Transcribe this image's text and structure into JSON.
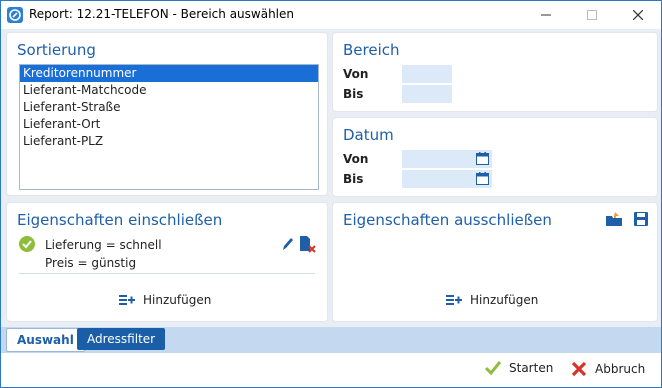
{
  "window": {
    "title": "Report: 12.21-TELEFON - Bereich auswählen"
  },
  "sortierung": {
    "title": "Sortierung",
    "items": [
      "Kreditorennummer",
      "Lieferant-Matchcode",
      "Lieferant-Straße",
      "Lieferant-Ort",
      "Lieferant-PLZ"
    ],
    "selected": "Kreditorennummer"
  },
  "bereich": {
    "title": "Bereich",
    "von_label": "Von",
    "bis_label": "Bis",
    "von_value": "",
    "bis_value": ""
  },
  "datum": {
    "title": "Datum",
    "von_label": "Von",
    "bis_label": "Bis",
    "von_value": "",
    "bis_value": ""
  },
  "include": {
    "title": "Eigenschaften einschließen",
    "line1": "Lieferung = schnell",
    "line2": "Preis = günstig",
    "add_label": "Hinzufügen"
  },
  "exclude": {
    "title": "Eigenschaften ausschließen",
    "add_label": "Hinzufügen"
  },
  "tabs": [
    {
      "label": "Auswahl",
      "active": true
    },
    {
      "label": "Adressfilter",
      "active": false
    }
  ],
  "footer": {
    "start_label": "Starten",
    "cancel_label": "Abbruch"
  },
  "colors": {
    "accent": "#1f5fa8",
    "selection": "#1a6fd6",
    "input_bg": "#dce9f8",
    "check": "#8dbd3b",
    "cancel": "#d8322b"
  }
}
